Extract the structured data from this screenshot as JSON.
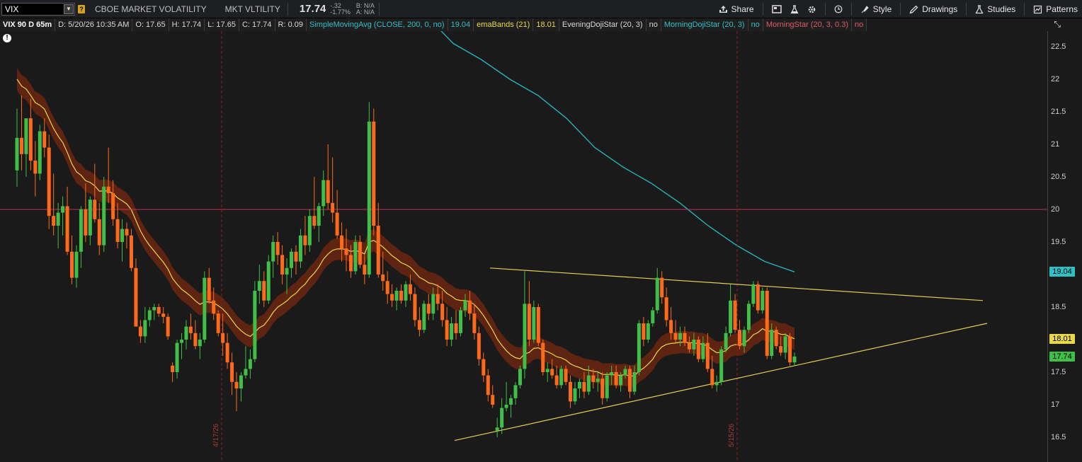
{
  "toolbar": {
    "symbol": "VIX",
    "description": "CBOE MARKET VOLATILITY",
    "short_description": "MKT VLTILITY",
    "last": "17.74",
    "change": "-.32",
    "change_pct": "-1.77%",
    "bid": "B: N/A",
    "ask": "A: N/A",
    "buttons": {
      "share": "Share",
      "style": "Style",
      "drawings": "Drawings",
      "studies": "Studies",
      "patterns": "Patterns"
    }
  },
  "info": {
    "symbol": "VIX 90 D 65m",
    "date": "D: 5/20/26 10:35 AM",
    "open": "O: 17.65",
    "high": "H: 17.74",
    "low": "L: 17.65",
    "close": "C: 17.74",
    "range": "R: 0.09",
    "sma_label": "SimpleMovingAvg (CLOSE, 200, 0, no)",
    "sma_value": "19.04",
    "ema_label": "emaBands (21)",
    "ema_value": "18.01",
    "evening_label": "EveningDojiStar (20, 3)",
    "evening_value": "no",
    "morningdoji_label": "MorningDojiStar (20, 3)",
    "morningdoji_value": "no",
    "morning_label": "MorningStar (20, 3, 0.3)",
    "morning_value": "no"
  },
  "colors": {
    "up": "#3fbf48",
    "down": "#ff6a1a",
    "sma": "#25b3b8",
    "ema": "#e8d84a",
    "band": "#6b2710",
    "hline": "#c0305a",
    "trendline": "#e0cf52",
    "datemarker": "#8a2020"
  },
  "price_axis": {
    "ticks": [
      "22.5",
      "22",
      "21.5",
      "21",
      "20.5",
      "20",
      "19.5",
      "19",
      "18.5",
      "18",
      "17.5",
      "17",
      "16.5"
    ],
    "tags": [
      {
        "text": "19.04",
        "value": 19.04,
        "color": "#2fc1c6"
      },
      {
        "text": "18.01",
        "value": 18.01,
        "color": "#e8d84a"
      },
      {
        "text": "17.74",
        "value": 17.74,
        "color": "#3fbf48"
      }
    ]
  },
  "date_markers": [
    "4/17/26",
    "5/15/26"
  ],
  "alert_icon": "alert-icon",
  "chart_data": {
    "type": "candlestick",
    "ylim": [
      16.25,
      22.85
    ],
    "horizontal_line": 20.0,
    "candles": [
      [
        20.6,
        21.55,
        20.35,
        21.1
      ],
      [
        21.1,
        21.75,
        20.6,
        20.85
      ],
      [
        20.85,
        21.25,
        20.5,
        21.4
      ],
      [
        21.4,
        21.7,
        20.6,
        20.75
      ],
      [
        20.75,
        21.05,
        20.2,
        20.55
      ],
      [
        20.55,
        21.3,
        20.45,
        21.2
      ],
      [
        21.2,
        21.4,
        20.8,
        20.95
      ],
      [
        20.95,
        21.15,
        19.7,
        19.9
      ],
      [
        19.9,
        20.55,
        19.6,
        19.75
      ],
      [
        19.75,
        20.1,
        19.4,
        19.95
      ],
      [
        19.95,
        20.2,
        19.6,
        20.05
      ],
      [
        20.05,
        20.35,
        19.3,
        19.35
      ],
      [
        19.35,
        19.6,
        18.85,
        18.95
      ],
      [
        18.95,
        19.45,
        18.8,
        19.35
      ],
      [
        19.35,
        20.05,
        19.1,
        20.0
      ],
      [
        20.0,
        20.4,
        19.5,
        19.6
      ],
      [
        19.6,
        20.2,
        19.45,
        20.15
      ],
      [
        20.15,
        20.7,
        19.8,
        19.85
      ],
      [
        19.85,
        20.1,
        19.3,
        19.45
      ],
      [
        19.45,
        20.5,
        19.35,
        20.35
      ],
      [
        20.35,
        20.95,
        20.1,
        20.25
      ],
      [
        20.25,
        20.45,
        19.75,
        19.85
      ],
      [
        19.85,
        20.1,
        19.4,
        19.5
      ],
      [
        19.5,
        19.85,
        19.2,
        19.7
      ],
      [
        19.7,
        19.8,
        19.4,
        19.6
      ],
      [
        19.6,
        19.7,
        19.05,
        19.1
      ],
      [
        19.1,
        19.25,
        18.55,
        18.2
      ],
      [
        18.2,
        18.3,
        17.95,
        18.05
      ],
      [
        18.05,
        18.5,
        17.95,
        18.3
      ],
      [
        18.3,
        18.5,
        18.2,
        18.45
      ],
      [
        18.45,
        18.55,
        18.3,
        18.5
      ],
      [
        18.5,
        18.55,
        18.35,
        18.4
      ],
      [
        18.4,
        18.5,
        18.25,
        18.35
      ],
      [
        18.35,
        18.4,
        18.0,
        18.05
      ],
      [
        17.6,
        17.65,
        17.35,
        17.5
      ],
      [
        17.5,
        18.0,
        17.4,
        17.95
      ],
      [
        17.95,
        18.1,
        17.7,
        18.0
      ],
      [
        18.0,
        18.3,
        17.85,
        18.2
      ],
      [
        18.2,
        18.4,
        18.0,
        18.1
      ],
      [
        18.1,
        18.3,
        17.85,
        17.9
      ],
      [
        17.9,
        18.1,
        17.7,
        18.0
      ],
      [
        18.0,
        19.05,
        17.95,
        18.95
      ],
      [
        18.95,
        19.1,
        18.55,
        18.6
      ],
      [
        18.6,
        18.8,
        18.3,
        18.4
      ],
      [
        18.4,
        18.45,
        18.05,
        18.1
      ],
      [
        18.1,
        18.4,
        17.75,
        17.95
      ],
      [
        17.95,
        18.1,
        17.55,
        17.65
      ],
      [
        17.65,
        17.8,
        17.15,
        17.35
      ],
      [
        17.35,
        17.5,
        16.9,
        17.25
      ],
      [
        17.25,
        17.5,
        17.05,
        17.45
      ],
      [
        17.45,
        17.9,
        17.4,
        17.55
      ],
      [
        17.55,
        17.85,
        17.4,
        17.7
      ],
      [
        17.7,
        18.9,
        17.65,
        18.75
      ],
      [
        18.75,
        19.15,
        18.55,
        18.9
      ],
      [
        18.9,
        19.05,
        18.5,
        18.6
      ],
      [
        18.6,
        19.3,
        18.55,
        19.2
      ],
      [
        19.2,
        19.6,
        18.95,
        19.5
      ],
      [
        19.5,
        19.65,
        19.15,
        19.3
      ],
      [
        19.3,
        19.45,
        18.85,
        19.0
      ],
      [
        19.0,
        19.25,
        18.7,
        19.1
      ],
      [
        19.1,
        19.4,
        18.95,
        19.35
      ],
      [
        19.35,
        19.45,
        19.0,
        19.2
      ],
      [
        19.2,
        19.7,
        19.1,
        19.6
      ],
      [
        19.6,
        19.9,
        19.3,
        19.45
      ],
      [
        19.45,
        20.0,
        19.35,
        19.9
      ],
      [
        19.9,
        20.5,
        19.7,
        19.75
      ],
      [
        19.75,
        20.1,
        19.5,
        20.05
      ],
      [
        20.05,
        20.6,
        19.9,
        20.45
      ],
      [
        20.45,
        21.0,
        20.0,
        20.1
      ],
      [
        20.1,
        20.8,
        19.8,
        19.95
      ],
      [
        19.95,
        20.3,
        19.55,
        19.6
      ],
      [
        19.6,
        19.8,
        19.2,
        19.4
      ],
      [
        19.4,
        19.7,
        19.05,
        19.3
      ],
      [
        19.3,
        19.45,
        18.95,
        19.05
      ],
      [
        19.05,
        19.6,
        19.0,
        19.5
      ],
      [
        19.5,
        19.6,
        19.1,
        19.15
      ],
      [
        19.15,
        19.3,
        18.85,
        19.0
      ],
      [
        19.0,
        21.65,
        18.95,
        21.35
      ],
      [
        21.35,
        21.55,
        19.6,
        19.75
      ],
      [
        19.75,
        20.1,
        18.95,
        19.0
      ],
      [
        19.0,
        19.35,
        18.75,
        18.9
      ],
      [
        18.9,
        19.05,
        18.55,
        18.7
      ],
      [
        18.7,
        18.85,
        18.5,
        18.6
      ],
      [
        18.6,
        18.8,
        18.45,
        18.75
      ],
      [
        18.75,
        18.85,
        18.55,
        18.6
      ],
      [
        18.6,
        18.9,
        18.5,
        18.85
      ],
      [
        18.85,
        19.0,
        18.6,
        18.7
      ],
      [
        18.7,
        18.8,
        18.2,
        18.3
      ],
      [
        18.3,
        18.5,
        18.05,
        18.15
      ],
      [
        18.15,
        18.6,
        18.1,
        18.55
      ],
      [
        18.55,
        18.7,
        18.3,
        18.4
      ],
      [
        18.4,
        18.8,
        18.3,
        18.7
      ],
      [
        18.7,
        18.85,
        18.45,
        18.55
      ],
      [
        18.55,
        18.75,
        18.2,
        18.3
      ],
      [
        18.3,
        18.5,
        17.9,
        18.0
      ],
      [
        18.0,
        18.35,
        17.9,
        18.25
      ],
      [
        18.25,
        18.45,
        18.0,
        18.1
      ],
      [
        18.1,
        18.5,
        18.05,
        18.45
      ],
      [
        18.45,
        18.7,
        18.35,
        18.6
      ],
      [
        18.6,
        18.75,
        18.3,
        18.4
      ],
      [
        18.4,
        18.55,
        18.0,
        18.1
      ],
      [
        18.1,
        18.2,
        17.6,
        17.7
      ],
      [
        17.7,
        17.8,
        17.35,
        17.45
      ],
      [
        17.45,
        17.55,
        17.05,
        17.15
      ],
      [
        17.15,
        17.3,
        16.95,
        17.0
      ],
      [
        16.6,
        16.8,
        16.5,
        16.65
      ],
      [
        16.65,
        17.1,
        16.55,
        16.95
      ],
      [
        16.95,
        17.35,
        16.9,
        17.0
      ],
      [
        17.0,
        17.15,
        16.8,
        17.1
      ],
      [
        17.1,
        17.35,
        17.0,
        17.3
      ],
      [
        17.3,
        17.6,
        17.25,
        17.55
      ],
      [
        17.55,
        19.05,
        17.4,
        18.55
      ],
      [
        18.55,
        18.9,
        17.9,
        18.0
      ],
      [
        18.0,
        18.6,
        17.95,
        18.5
      ],
      [
        18.5,
        18.55,
        17.9,
        17.95
      ],
      [
        17.95,
        18.0,
        17.45,
        17.5
      ],
      [
        17.5,
        17.65,
        17.35,
        17.55
      ],
      [
        17.55,
        17.7,
        17.4,
        17.45
      ],
      [
        17.45,
        17.6,
        17.25,
        17.3
      ],
      [
        17.3,
        17.6,
        17.25,
        17.55
      ],
      [
        17.55,
        17.6,
        17.3,
        17.35
      ],
      [
        17.35,
        17.45,
        16.95,
        17.05
      ],
      [
        17.05,
        17.35,
        17.0,
        17.25
      ],
      [
        17.25,
        17.4,
        17.1,
        17.35
      ],
      [
        17.35,
        17.5,
        17.1,
        17.2
      ],
      [
        17.2,
        17.6,
        17.15,
        17.45
      ],
      [
        17.45,
        17.55,
        17.25,
        17.35
      ],
      [
        17.35,
        17.5,
        17.2,
        17.4
      ],
      [
        17.4,
        17.5,
        17.0,
        17.1
      ],
      [
        17.1,
        17.5,
        17.05,
        17.45
      ],
      [
        17.45,
        17.6,
        17.3,
        17.5
      ],
      [
        17.5,
        17.6,
        17.25,
        17.3
      ],
      [
        17.3,
        17.5,
        17.2,
        17.45
      ],
      [
        17.45,
        17.6,
        17.4,
        17.55
      ],
      [
        17.55,
        17.6,
        17.1,
        17.2
      ],
      [
        17.2,
        17.6,
        17.15,
        17.5
      ],
      [
        17.5,
        18.3,
        17.45,
        18.25
      ],
      [
        18.25,
        18.35,
        17.9,
        18.0
      ],
      [
        18.0,
        18.3,
        17.95,
        18.25
      ],
      [
        18.25,
        18.5,
        18.2,
        18.45
      ],
      [
        18.45,
        19.1,
        18.4,
        18.95
      ],
      [
        18.95,
        19.05,
        18.55,
        18.65
      ],
      [
        18.65,
        18.8,
        18.2,
        18.3
      ],
      [
        18.3,
        18.5,
        18.0,
        18.1
      ],
      [
        18.1,
        18.3,
        17.95,
        18.0
      ],
      [
        18.0,
        18.2,
        17.9,
        18.1
      ],
      [
        18.1,
        18.2,
        17.9,
        17.95
      ],
      [
        17.95,
        18.05,
        17.8,
        17.85
      ],
      [
        17.85,
        18.1,
        17.75,
        18.0
      ],
      [
        18.0,
        18.05,
        17.65,
        17.7
      ],
      [
        17.7,
        18.05,
        17.65,
        17.95
      ],
      [
        17.95,
        18.1,
        17.5,
        17.55
      ],
      [
        17.55,
        17.75,
        17.25,
        17.3
      ],
      [
        17.3,
        17.45,
        17.2,
        17.35
      ],
      [
        17.35,
        17.9,
        17.3,
        17.85
      ],
      [
        17.85,
        18.2,
        17.8,
        18.1
      ],
      [
        18.1,
        18.85,
        18.05,
        18.6
      ],
      [
        18.6,
        18.7,
        18.1,
        18.15
      ],
      [
        18.15,
        18.3,
        17.85,
        17.9
      ],
      [
        17.9,
        18.2,
        17.8,
        18.15
      ],
      [
        18.15,
        18.6,
        18.1,
        18.55
      ],
      [
        18.55,
        18.9,
        18.5,
        18.85
      ],
      [
        18.85,
        18.9,
        18.4,
        18.45
      ],
      [
        18.45,
        18.8,
        18.4,
        18.75
      ],
      [
        18.75,
        18.8,
        17.7,
        17.75
      ],
      [
        17.75,
        18.25,
        17.7,
        18.15
      ],
      [
        18.15,
        18.2,
        17.85,
        17.9
      ],
      [
        17.9,
        18.05,
        17.75,
        17.8
      ],
      [
        17.8,
        18.1,
        17.7,
        18.05
      ],
      [
        18.05,
        18.1,
        17.6,
        17.65
      ],
      [
        17.65,
        17.8,
        17.6,
        17.74
      ]
    ],
    "sma200": [
      [
        600,
        23.0
      ],
      [
        640,
        22.55
      ],
      [
        680,
        22.3
      ],
      [
        720,
        22.0
      ],
      [
        760,
        21.75
      ],
      [
        800,
        21.4
      ],
      [
        840,
        20.95
      ],
      [
        880,
        20.65
      ],
      [
        920,
        20.4
      ],
      [
        960,
        20.1
      ],
      [
        1000,
        19.75
      ],
      [
        1040,
        19.45
      ],
      [
        1080,
        19.2
      ],
      [
        1122,
        19.04
      ]
    ],
    "trendlines": [
      {
        "from": [
          692,
          19.1
        ],
        "to": [
          1388,
          18.6
        ]
      },
      {
        "from": [
          642,
          16.45
        ],
        "to": [
          1394,
          18.25
        ]
      }
    ]
  }
}
